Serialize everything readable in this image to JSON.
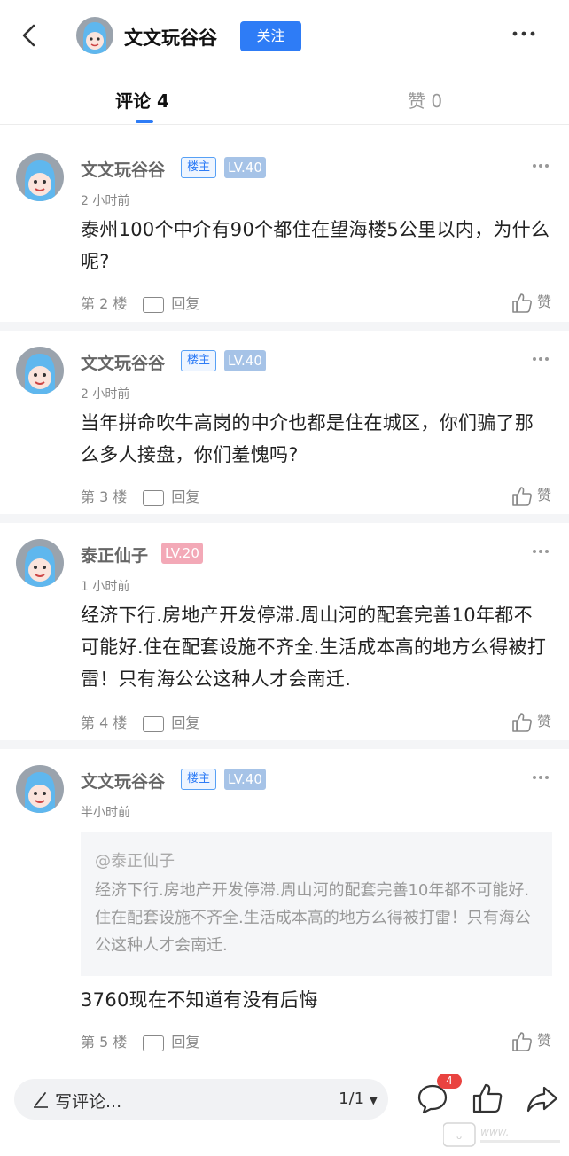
{
  "header": {
    "title": "文文玩谷谷",
    "follow_label": "关注",
    "icons": {
      "back": "chevron-left-icon",
      "more": "more-dots-icon"
    }
  },
  "tabs": [
    {
      "label": "评论 4",
      "active": true
    },
    {
      "label": "赞 0",
      "active": false
    }
  ],
  "colors": {
    "accent": "#2e7cf6",
    "lv_blue": "#a6c3e7",
    "lv_pink": "#f3a9b7",
    "badge_red": "#e94340"
  },
  "comments": [
    {
      "name": "文文玩谷谷",
      "owner_badge": "楼主",
      "level": "LV.40",
      "time": "2 小时前",
      "text": "泰州100个中介有90个都住在望海楼5公里以内，为什么呢?",
      "floor": "第 2 楼",
      "reply": "回复",
      "like": "赞"
    },
    {
      "name": "文文玩谷谷",
      "owner_badge": "楼主",
      "level": "LV.40",
      "time": "2 小时前",
      "text": "当年拼命吹牛高岗的中介也都是住在城区，你们骗了那么多人接盘，你们羞愧吗?",
      "floor": "第 3 楼",
      "reply": "回复",
      "like": "赞"
    },
    {
      "name": "泰正仙子",
      "level": "LV.20",
      "time": "1 小时前",
      "text": "经济下行.房地产开发停滞.周山河的配套完善10年都不可能好.住在配套设施不齐全.生活成本高的地方么得被打雷！只有海公公这种人才会南迁.",
      "floor": "第 4 楼",
      "reply": "回复",
      "like": "赞"
    },
    {
      "name": "文文玩谷谷",
      "owner_badge": "楼主",
      "level": "LV.40",
      "time": "半小时前",
      "quote_at": "@泰正仙子",
      "quote_text": "经济下行.房地产开发停滞.周山河的配套完善10年都不可能好.住在配套设施不齐全.生活成本高的地方么得被打雷！只有海公公这种人才会南迁.",
      "text": "3760现在不知道有没有后悔",
      "floor": "第 5 楼",
      "reply": "回复",
      "like": "赞"
    }
  ],
  "bottom_bar": {
    "input_placeholder": "写评论...",
    "pager": "1/1",
    "comment_count": "4",
    "icons": {
      "pen": "pen-icon",
      "comment": "comment-icon",
      "like": "thumb-up-icon",
      "share": "share-icon"
    }
  }
}
